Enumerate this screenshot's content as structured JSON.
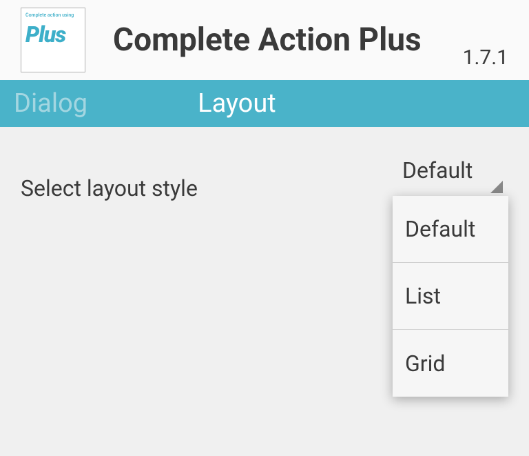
{
  "header": {
    "icon_toptext": "Complete action using",
    "icon_logo": "Plus",
    "title": "Complete Action Plus",
    "version": "1.7.1"
  },
  "tabs": {
    "inactive": "Dialog",
    "active": "Layout"
  },
  "content": {
    "setting_label": "Select layout style",
    "spinner_value": "Default",
    "dropdown": {
      "option0": "Default",
      "option1": "List",
      "option2": "Grid"
    }
  }
}
